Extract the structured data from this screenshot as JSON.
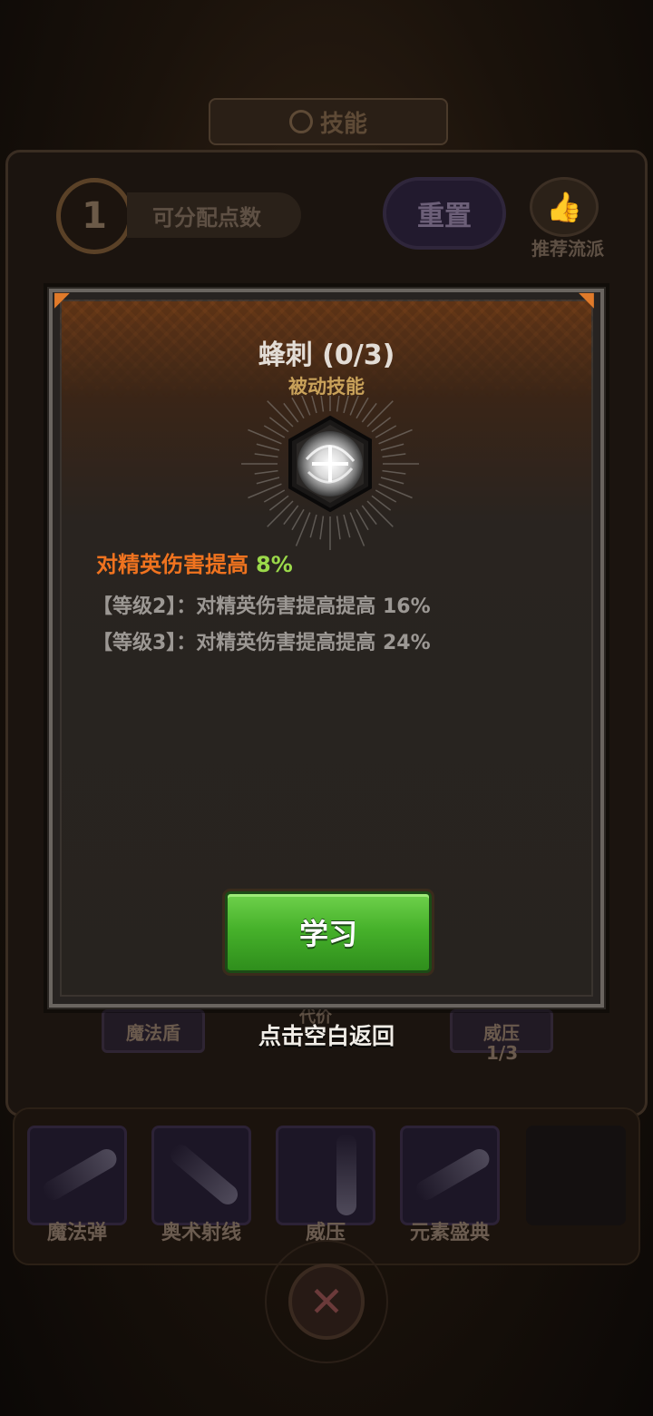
{
  "screen": {
    "title": "技能",
    "available_points": "1",
    "points_label": "可分配点数",
    "reset_label": "重置",
    "recommend_label": "推荐流派"
  },
  "skill_tree": {
    "nodes": [
      {
        "label": "魔法盾"
      },
      {
        "label": "威压",
        "level": "1/3"
      }
    ],
    "cost_label": "代价"
  },
  "equipped_skills": [
    {
      "label": "魔法弹"
    },
    {
      "label": "奥术射线"
    },
    {
      "label": "威压"
    },
    {
      "label": "元素盛典"
    }
  ],
  "modal": {
    "skill_name": "蜂刺 (0/3)",
    "skill_type": "被动技能",
    "icon": "swirl-orb-icon",
    "effect_label": "对精英伤害提高",
    "effect_value": "8%",
    "levels": [
      {
        "text": "【等级2】：对精英伤害提高提高 16%"
      },
      {
        "text": "【等级3】：对精英伤害提高提高 24%"
      }
    ],
    "learn_button": "学习",
    "close_hint": "点击空白返回"
  },
  "colors": {
    "effect_label": "#f0731f",
    "effect_value": "#9bd94a",
    "skill_type": "#c9a25a",
    "learn_button": "#47b22b"
  }
}
